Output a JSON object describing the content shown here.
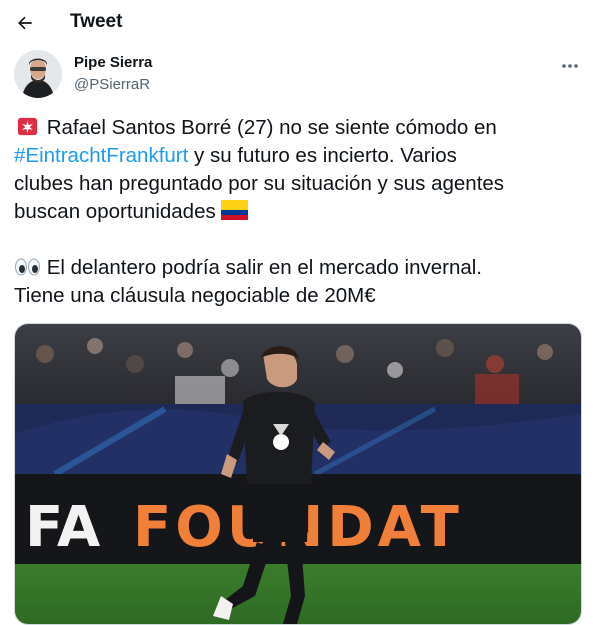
{
  "header": {
    "title": "Tweet",
    "back_icon": "arrow-left-icon"
  },
  "author": {
    "name": "Pipe Sierra",
    "handle": "@PSierraR"
  },
  "tweet": {
    "line1_pre": "Rafael Santos Borré (27) no se siente cómodo en",
    "hashtag": "#EintrachtFrankfurt",
    "line2_post": " y su futuro es incierto. Varios",
    "line3": "clubes han preguntado por su situación y sus agentes",
    "line4": "buscan oportunidades",
    "line5": "El delantero podría salir en el mercado invernal.",
    "line6": "Tiene una cláusula negociable de 20M€"
  },
  "media": {
    "banner_left": "FA",
    "banner_right": "FOUNDAT",
    "icon": "ucl-starball-icon"
  },
  "colors": {
    "link": "#1d9bf0",
    "muted": "#536471"
  }
}
